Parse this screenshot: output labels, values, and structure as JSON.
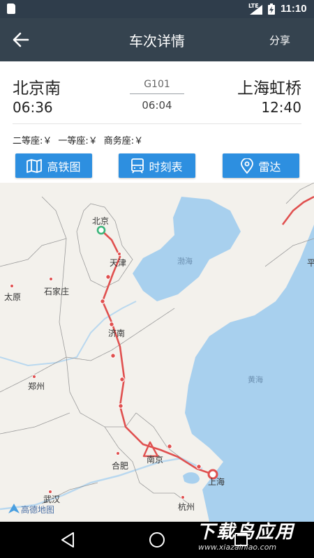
{
  "status": {
    "network": "LTE",
    "time": "11:10"
  },
  "header": {
    "title": "车次详情",
    "share_label": "分享"
  },
  "journey": {
    "from_station": "北京南",
    "from_time": "06:36",
    "to_station": "上海虹桥",
    "to_time": "12:40",
    "train_no": "G101",
    "duration": "06:04"
  },
  "seats": [
    "二等座:￥",
    "一等座:￥",
    "商务座:￥"
  ],
  "actions": {
    "map_label": "高铁图",
    "schedule_label": "时刻表",
    "radar_label": "雷达"
  },
  "map": {
    "cities": {
      "beijing": "北京",
      "tianjin": "天津",
      "taiyuan": "太原",
      "shijiazhuang": "石家庄",
      "jinan": "济南",
      "zhengzhou": "郑州",
      "nanjing": "南京",
      "hefei": "合肥",
      "shanghai": "上海",
      "wuhan": "武汉",
      "hangzhou": "杭州",
      "partial_east": "平"
    },
    "seas": {
      "bohai": "渤海",
      "huanghai": "黄海"
    },
    "provider": "高德地图",
    "route_color": "#e0504f",
    "water_color": "#a8d0ee"
  },
  "watermark": {
    "title": "下载鸟应用",
    "url": "www.xiazainiao.com"
  }
}
